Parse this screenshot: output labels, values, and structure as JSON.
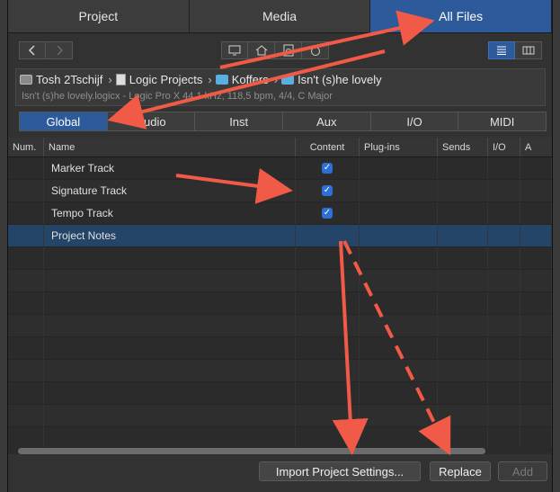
{
  "top_tabs": [
    {
      "label": "Project",
      "active": false
    },
    {
      "label": "Media",
      "active": false
    },
    {
      "label": "All Files",
      "active": true
    }
  ],
  "toolbar": {
    "back_icon": "chevron-left-icon",
    "forward_icon": "chevron-right-icon",
    "location_icons": [
      "computer-icon",
      "home-icon",
      "project-icon",
      "recent-icon"
    ],
    "view_icons": [
      "list-view-icon",
      "column-view-icon"
    ]
  },
  "path": {
    "segments": [
      {
        "label": "Tosh 2Tschijf",
        "icon": "drive-icon"
      },
      {
        "label": "Logic Projects",
        "icon": "document-icon"
      },
      {
        "label": "Koffers",
        "icon": "folder-icon"
      },
      {
        "label": "Isn't (s)he lovely",
        "icon": "folder-icon"
      }
    ],
    "info": "Isn't (s)he lovely.logicx - Logic Pro X 44,1 kHz, 118,5 bpm, 4/4, C Major"
  },
  "category_tabs": [
    {
      "label": "Global",
      "active": true
    },
    {
      "label": "Audio",
      "active": false
    },
    {
      "label": "Inst",
      "active": false
    },
    {
      "label": "Aux",
      "active": false
    },
    {
      "label": "I/O",
      "active": false
    },
    {
      "label": "MIDI",
      "active": false
    }
  ],
  "table": {
    "columns": [
      "Num.",
      "Name",
      "Content",
      "Plug-ins",
      "Sends",
      "I/O",
      "A"
    ],
    "rows": [
      {
        "num": "",
        "name": "Marker Track",
        "content_checked": true,
        "selected": false
      },
      {
        "num": "",
        "name": "Signature Track",
        "content_checked": true,
        "selected": false
      },
      {
        "num": "",
        "name": "Tempo Track",
        "content_checked": true,
        "selected": false
      },
      {
        "num": "",
        "name": "Project Notes",
        "content_checked": false,
        "selected": true
      }
    ]
  },
  "footer": {
    "import_label": "Import Project Settings...",
    "replace_label": "Replace",
    "add_label": "Add"
  },
  "colors": {
    "accent": "#2d5a9a",
    "annotation_arrow": "#f05a46",
    "checkbox": "#2d6fd6"
  }
}
